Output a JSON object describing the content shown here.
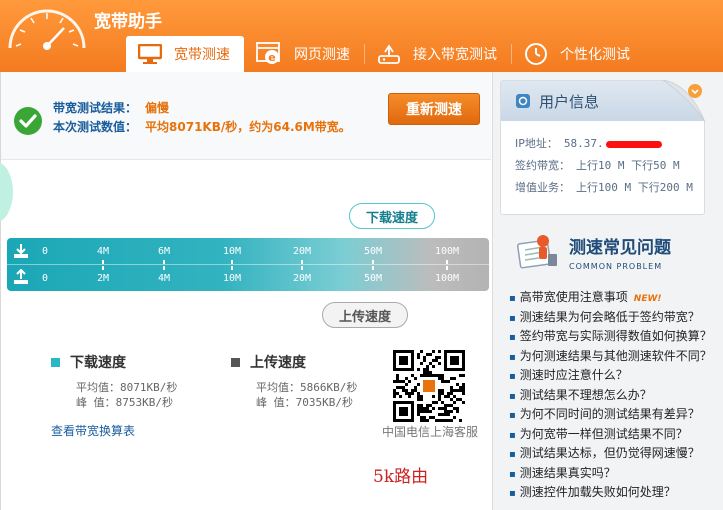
{
  "app": {
    "title": "宽带助手"
  },
  "tabs": [
    {
      "label": "宽带测速",
      "icon": "monitor-icon",
      "active": true
    },
    {
      "label": "网页测速",
      "icon": "browser-icon",
      "active": false
    },
    {
      "label": "接入带宽测试",
      "icon": "router-icon",
      "active": false
    },
    {
      "label": "个性化测试",
      "icon": "clock-icon",
      "active": false
    }
  ],
  "result": {
    "label1": "带宽测试结果：",
    "value1": "偏慢",
    "label2": "本次测试数值：",
    "value2": "平均8071KB/秒，约为64.6M带宽。",
    "retest": "重新测速"
  },
  "scale": {
    "download_label": "下载速度",
    "upload_label": "上传速度",
    "download_ticks": [
      "0",
      "4M",
      "6M",
      "10M",
      "20M",
      "50M",
      "100M"
    ],
    "upload_ticks": [
      "0",
      "2M",
      "4M",
      "10M",
      "20M",
      "50M",
      "100M"
    ]
  },
  "stats": {
    "download": {
      "title": "下载速度",
      "avg": "平均值：8071KB/秒",
      "peak": "峰  值：8753KB/秒",
      "color": "#2ab7c4"
    },
    "upload": {
      "title": "上传速度",
      "avg": "平均值：5866KB/秒",
      "peak": "峰  值：7035KB/秒",
      "color": "#555555"
    }
  },
  "conversion_link": "查看带宽换算表",
  "qr_caption": "中国电信上海客服",
  "watermark": "5k路由",
  "user_info": {
    "title": "用户信息",
    "ip_label": "IP地址：",
    "ip_value": "58.37.",
    "contract_label": "签约带宽：",
    "contract_value": "上行10 M 下行50 M",
    "addon_label": "增值业务：",
    "addon_value": "上行100 M 下行200 M"
  },
  "faq": {
    "title": "测速常见问题",
    "subtitle": "COMMON PROBLEM",
    "new_badge": "NEW!",
    "items": [
      "高带宽使用注意事项",
      "测速结果为何会略低于签约带宽？",
      "签约带宽与实际测得数值如何换算？",
      "为何测速结果与其他测速软件不同？",
      "测速时应注意什么？",
      "测试结果不理想怎么办？",
      "为何不同时间的测试结果有差异？",
      "为何宽带一样但测试结果不同？",
      "测试结果达标，但仍觉得网速慢？",
      "测速结果真实吗？",
      "测速控件加载失败如何处理？"
    ]
  }
}
